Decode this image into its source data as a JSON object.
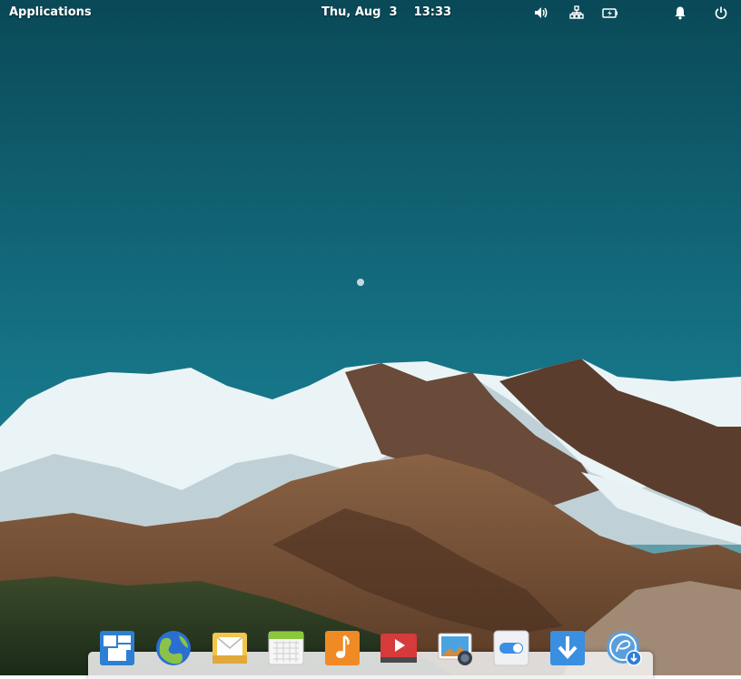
{
  "panel": {
    "applications_label": "Applications",
    "date": "Thu, Aug  3",
    "time": "13:33",
    "indicators": [
      "volume-icon",
      "network-icon",
      "battery-icon",
      "notifications-icon",
      "power-icon"
    ]
  },
  "dock": {
    "apps": [
      "multitasking-view",
      "web-browser",
      "mail",
      "calendar",
      "music",
      "videos",
      "photos",
      "system-settings",
      "appcenter",
      "installer"
    ]
  },
  "colors": {
    "sky_top": "#0a4a59",
    "sky_bottom": "#1a8091",
    "snow": "#e8f3f5",
    "rock": "#6e4a32",
    "forest": "#2a3b22"
  }
}
